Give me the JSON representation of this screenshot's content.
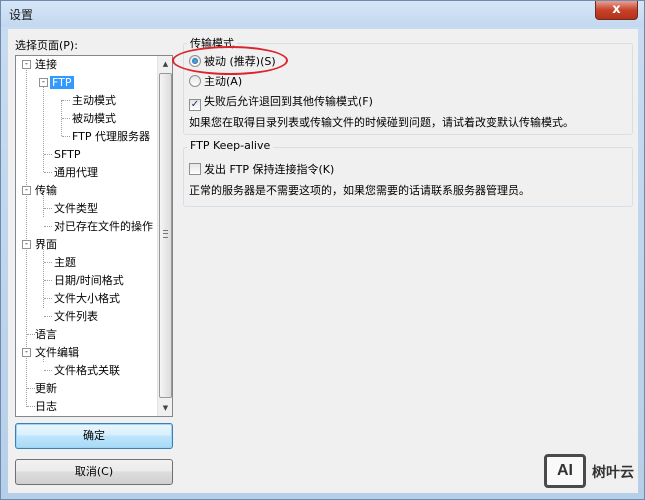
{
  "window": {
    "title": "设置",
    "close_glyph": "x"
  },
  "left": {
    "label": "选择页面(P):",
    "tree": [
      {
        "label": "连接",
        "expander": "-"
      },
      {
        "label": "FTP",
        "expander": "-",
        "selected": true
      },
      {
        "label": "主动模式"
      },
      {
        "label": "被动模式"
      },
      {
        "label": "FTP 代理服务器"
      },
      {
        "label": "SFTP"
      },
      {
        "label": "通用代理"
      },
      {
        "label": "传输",
        "expander": "-"
      },
      {
        "label": "文件类型"
      },
      {
        "label": "对已存在文件的操作"
      },
      {
        "label": "界面",
        "expander": "-"
      },
      {
        "label": "主题"
      },
      {
        "label": "日期/时间格式"
      },
      {
        "label": "文件大小格式"
      },
      {
        "label": "文件列表"
      },
      {
        "label": "语言"
      },
      {
        "label": "文件编辑",
        "expander": "-"
      },
      {
        "label": "文件格式关联"
      },
      {
        "label": "更新"
      },
      {
        "label": "日志"
      }
    ],
    "ok_button": "确定",
    "cancel_button": "取消(C)"
  },
  "transfer_mode": {
    "title": "传输模式",
    "passive_label": "被动 (推荐)(S)",
    "passive_checked": true,
    "active_label": "主动(A)",
    "active_checked": false,
    "fallback_label": "失败后允许退回到其他传输模式(F)",
    "fallback_checked": true,
    "hint": "如果您在取得目录列表或传输文件的时候碰到问题，请试着改变默认传输模式。"
  },
  "keepalive": {
    "title": "FTP Keep-alive",
    "send_label": "发出 FTP 保持连接指令(K)",
    "send_checked": false,
    "hint": "正常的服务器是不需要这项的，如果您需要的话请联系服务器管理员。"
  },
  "watermark": {
    "box": "AI",
    "text": "树叶云"
  },
  "colors": {
    "selection": "#3399ff",
    "highlight_oval": "#d9252c",
    "default_button_border": "#3c7fb1"
  }
}
